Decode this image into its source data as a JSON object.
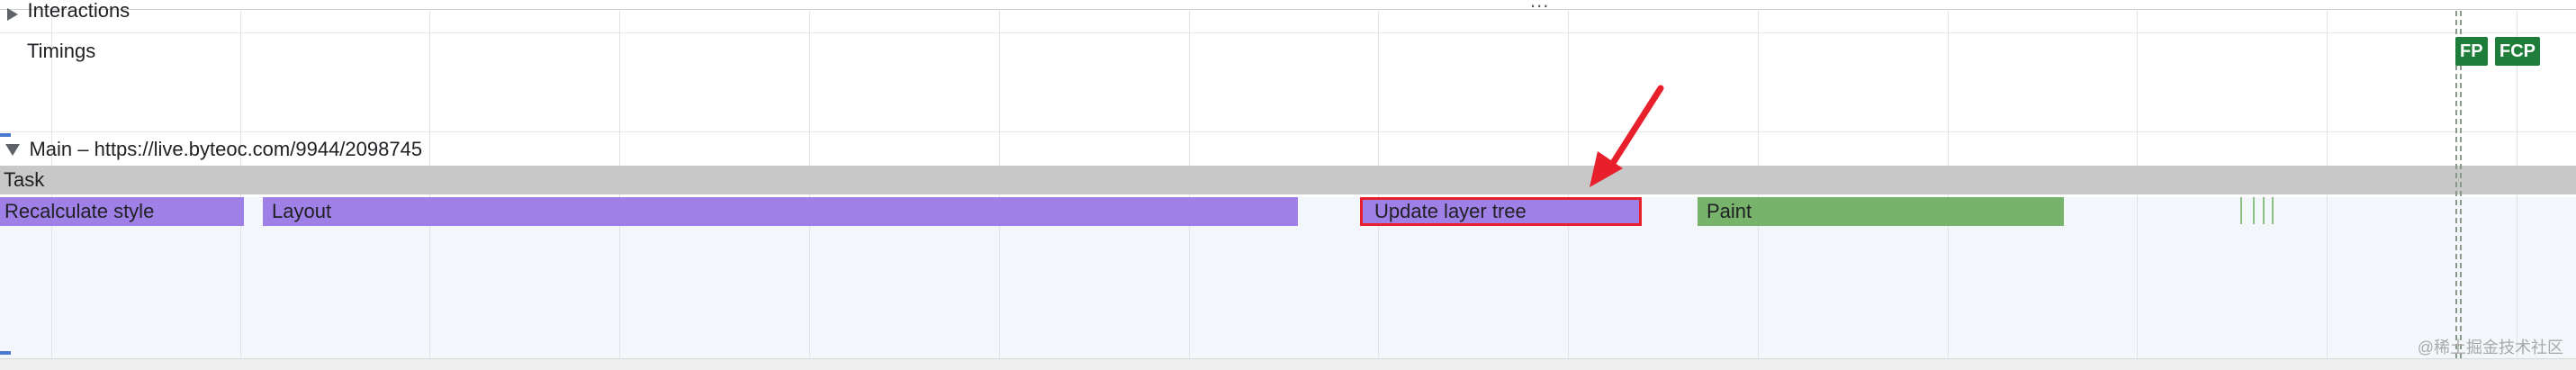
{
  "header": {
    "ellipsis": "..."
  },
  "tracks": {
    "interactions_label": "Interactions",
    "timings_label": "Timings",
    "main_label": "Main – https://live.byteoc.com/9944/2098745"
  },
  "timing_markers": {
    "fp": "FP",
    "fcp": "FCP"
  },
  "flame": {
    "task_label": "Task",
    "events": [
      {
        "name": "Recalculate style",
        "category": "rendering",
        "color": "#9f80e6"
      },
      {
        "name": "Layout",
        "category": "rendering",
        "color": "#9f80e6"
      },
      {
        "name": "Update layer tree",
        "category": "rendering",
        "color": "#9f80e6",
        "highlighted": true
      },
      {
        "name": "Paint",
        "category": "painting",
        "color": "#77b36b"
      }
    ]
  },
  "annotation": {
    "arrow_color": "#e8202c",
    "box_color": "#e8202c"
  },
  "watermark": "@稀土掘金技术社区"
}
